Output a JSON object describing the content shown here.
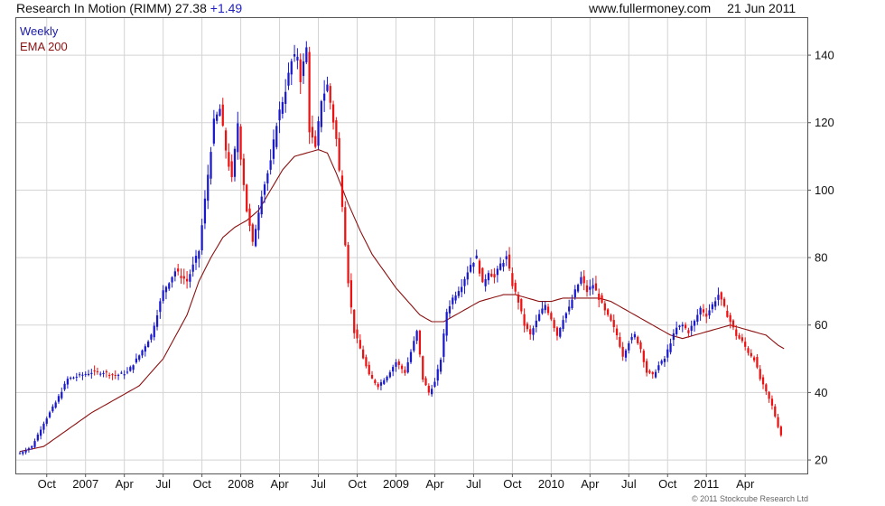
{
  "header": {
    "title": "Research In Motion (RIMM)",
    "price": "27.38",
    "change": "+1.49",
    "site": "www.fullermoney.com",
    "date": "21 Jun 2011"
  },
  "legend": {
    "period": "Weekly",
    "ema": "EMA 200"
  },
  "copyright": "© 2011 Stockcube Research Ltd",
  "colors": {
    "up": "#1a1acc",
    "down": "#ee1111",
    "ema": "#8b1010",
    "grid": "#d3d3d3",
    "title_change": "#1f1fbf"
  },
  "chart_data": {
    "type": "candlestick",
    "title": "Research In Motion (RIMM)",
    "period": "Weekly",
    "y_axis_side": "right",
    "ylim": [
      16,
      151
    ],
    "yticks": [
      20,
      40,
      60,
      80,
      100,
      120,
      140
    ],
    "xlim": [
      0,
      262
    ],
    "xticks": [
      {
        "label": "Oct",
        "x": 9
      },
      {
        "label": "2007",
        "x": 22
      },
      {
        "label": "Apr",
        "x": 35
      },
      {
        "label": "Jul",
        "x": 48
      },
      {
        "label": "Oct",
        "x": 61
      },
      {
        "label": "2008",
        "x": 74
      },
      {
        "label": "Apr",
        "x": 87
      },
      {
        "label": "Jul",
        "x": 100
      },
      {
        "label": "Oct",
        "x": 113
      },
      {
        "label": "2009",
        "x": 126
      },
      {
        "label": "Apr",
        "x": 139
      },
      {
        "label": "Jul",
        "x": 152
      },
      {
        "label": "Oct",
        "x": 165
      },
      {
        "label": "2010",
        "x": 178
      },
      {
        "label": "Apr",
        "x": 191
      },
      {
        "label": "Jul",
        "x": 204
      },
      {
        "label": "Oct",
        "x": 217
      },
      {
        "label": "2011",
        "x": 230
      },
      {
        "label": "Apr",
        "x": 243
      }
    ],
    "ema_label": "EMA 200",
    "close_anchors": [
      [
        0,
        22
      ],
      [
        4,
        24
      ],
      [
        8,
        31
      ],
      [
        12,
        37
      ],
      [
        16,
        44
      ],
      [
        20,
        45
      ],
      [
        24,
        46
      ],
      [
        28,
        46
      ],
      [
        32,
        45
      ],
      [
        36,
        46
      ],
      [
        40,
        51
      ],
      [
        44,
        57
      ],
      [
        48,
        70
      ],
      [
        52,
        76
      ],
      [
        56,
        73
      ],
      [
        60,
        82
      ],
      [
        62,
        97
      ],
      [
        65,
        120
      ],
      [
        67,
        124
      ],
      [
        69,
        112
      ],
      [
        71,
        103
      ],
      [
        73,
        120
      ],
      [
        74,
        110
      ],
      [
        76,
        94
      ],
      [
        78,
        84
      ],
      [
        81,
        99
      ],
      [
        84,
        108
      ],
      [
        86,
        120
      ],
      [
        89,
        130
      ],
      [
        91,
        138
      ],
      [
        93,
        140
      ],
      [
        94,
        133
      ],
      [
        96,
        142
      ],
      [
        97,
        118
      ],
      [
        99,
        112
      ],
      [
        101,
        127
      ],
      [
        103,
        131
      ],
      [
        104,
        126
      ],
      [
        106,
        115
      ],
      [
        108,
        96
      ],
      [
        110,
        73
      ],
      [
        111,
        65
      ],
      [
        112,
        58
      ],
      [
        114,
        53
      ],
      [
        117,
        45
      ],
      [
        120,
        42
      ],
      [
        123,
        45
      ],
      [
        126,
        49
      ],
      [
        129,
        46
      ],
      [
        132,
        55
      ],
      [
        133,
        58
      ],
      [
        135,
        44
      ],
      [
        137,
        40
      ],
      [
        139,
        43
      ],
      [
        141,
        50
      ],
      [
        143,
        64
      ],
      [
        145,
        68
      ],
      [
        148,
        72
      ],
      [
        151,
        78
      ],
      [
        153,
        80
      ],
      [
        155,
        72
      ],
      [
        157,
        76
      ],
      [
        159,
        74
      ],
      [
        161,
        78
      ],
      [
        163,
        80
      ],
      [
        165,
        72
      ],
      [
        167,
        67
      ],
      [
        169,
        60
      ],
      [
        171,
        57
      ],
      [
        174,
        63
      ],
      [
        176,
        66
      ],
      [
        178,
        62
      ],
      [
        180,
        57
      ],
      [
        182,
        62
      ],
      [
        184,
        65
      ],
      [
        186,
        70
      ],
      [
        188,
        74
      ],
      [
        190,
        70
      ],
      [
        192,
        72
      ],
      [
        194,
        68
      ],
      [
        196,
        64
      ],
      [
        198,
        61
      ],
      [
        200,
        57
      ],
      [
        202,
        51
      ],
      [
        204,
        55
      ],
      [
        206,
        57
      ],
      [
        208,
        53
      ],
      [
        210,
        46
      ],
      [
        212,
        45
      ],
      [
        214,
        48
      ],
      [
        216,
        50
      ],
      [
        218,
        55
      ],
      [
        220,
        59
      ],
      [
        222,
        60
      ],
      [
        224,
        58
      ],
      [
        226,
        61
      ],
      [
        228,
        65
      ],
      [
        230,
        63
      ],
      [
        232,
        66
      ],
      [
        234,
        69
      ],
      [
        236,
        65
      ],
      [
        238,
        61
      ],
      [
        240,
        57
      ],
      [
        242,
        55
      ],
      [
        244,
        52
      ],
      [
        246,
        50
      ],
      [
        248,
        44
      ],
      [
        250,
        40
      ],
      [
        252,
        36
      ],
      [
        254,
        30
      ],
      [
        255,
        27.4
      ]
    ],
    "ema_anchors": [
      [
        0,
        22.5
      ],
      [
        8,
        24
      ],
      [
        16,
        29
      ],
      [
        24,
        34
      ],
      [
        32,
        38
      ],
      [
        40,
        42
      ],
      [
        48,
        50
      ],
      [
        56,
        63
      ],
      [
        60,
        73
      ],
      [
        64,
        80
      ],
      [
        68,
        86
      ],
      [
        72,
        89
      ],
      [
        76,
        91
      ],
      [
        80,
        94
      ],
      [
        84,
        100
      ],
      [
        88,
        106
      ],
      [
        92,
        110
      ],
      [
        96,
        111
      ],
      [
        100,
        112
      ],
      [
        103,
        111
      ],
      [
        106,
        105
      ],
      [
        110,
        96
      ],
      [
        114,
        88
      ],
      [
        118,
        81
      ],
      [
        122,
        76
      ],
      [
        126,
        71
      ],
      [
        130,
        67
      ],
      [
        134,
        63
      ],
      [
        138,
        61
      ],
      [
        142,
        61
      ],
      [
        146,
        63
      ],
      [
        150,
        65
      ],
      [
        154,
        67
      ],
      [
        158,
        68
      ],
      [
        162,
        69
      ],
      [
        166,
        69
      ],
      [
        170,
        68
      ],
      [
        174,
        67
      ],
      [
        178,
        67
      ],
      [
        182,
        68
      ],
      [
        186,
        68
      ],
      [
        190,
        68
      ],
      [
        194,
        68
      ],
      [
        198,
        67
      ],
      [
        202,
        65
      ],
      [
        206,
        63
      ],
      [
        210,
        61
      ],
      [
        214,
        59
      ],
      [
        218,
        57
      ],
      [
        222,
        56
      ],
      [
        226,
        57
      ],
      [
        230,
        58
      ],
      [
        234,
        59
      ],
      [
        238,
        60
      ],
      [
        242,
        59
      ],
      [
        246,
        58
      ],
      [
        250,
        57
      ],
      [
        254,
        54
      ],
      [
        256,
        53
      ]
    ]
  }
}
